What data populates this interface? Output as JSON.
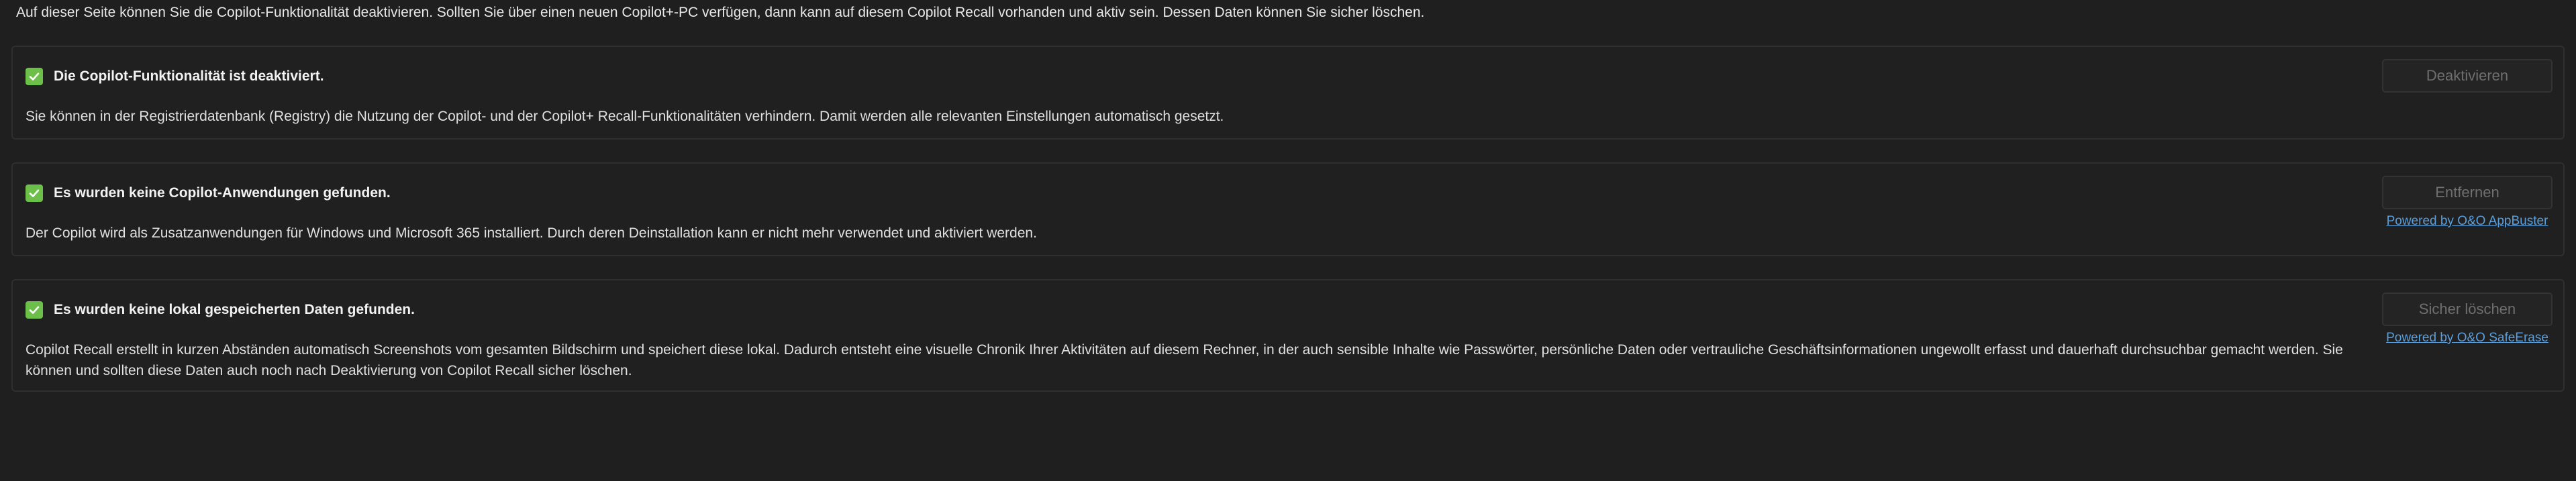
{
  "intro": "Auf dieser Seite können Sie die Copilot-Funktionalität deaktivieren. Sollten Sie über einen neuen Copilot+-PC verfügen, dann kann auf diesem Copilot Recall vorhanden und aktiv sein. Dessen Daten können Sie sicher löschen.",
  "sections": [
    {
      "title": "Die Copilot-Funktionalität ist deaktiviert.",
      "description": "Sie können in der Registrierdatenbank (Registry) die Nutzung der Copilot- und der Copilot+ Recall-Funktionalitäten verhindern. Damit werden alle relevanten Einstellungen automatisch gesetzt.",
      "button": "Deaktivieren",
      "status": "checked"
    },
    {
      "title": "Es wurden keine Copilot-Anwendungen gefunden.",
      "description": "Der Copilot wird als Zusatzanwendungen für Windows und Microsoft 365 installiert. Durch deren Deinstallation kann er nicht mehr verwendet und aktiviert werden.",
      "button": "Entfernen",
      "link": "Powered by O&O AppBuster",
      "status": "checked"
    },
    {
      "title": "Es wurden keine lokal gespeicherten Daten gefunden.",
      "description": "Copilot Recall erstellt in kurzen Abständen automatisch Screenshots vom gesamten Bildschirm und speichert diese lokal. Dadurch entsteht eine visuelle Chronik Ihrer Aktivitäten auf diesem Rechner, in der auch sensible Inhalte wie Passwörter, persönliche Daten oder vertrauliche Geschäftsinformationen ungewollt erfasst und dauerhaft durchsuchbar gemacht werden. Sie können und sollten diese Daten auch noch nach Deaktivierung von Copilot Recall sicher löschen.",
      "button": "Sicher löschen",
      "link": "Powered by O&O SafeErase",
      "status": "checked"
    }
  ],
  "colors": {
    "background": "#1f1f1f",
    "card_border": "#2f2f2f",
    "check_green": "#6cc04a",
    "link_blue": "#5b9fdc",
    "button_disabled_text": "#6f6f6f"
  },
  "icons": {
    "status": "checkmark-icon"
  }
}
